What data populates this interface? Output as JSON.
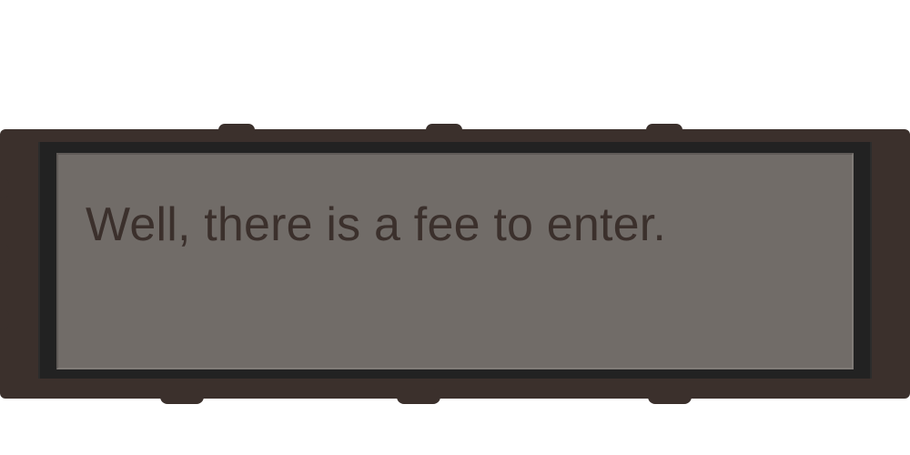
{
  "dialog": {
    "text": "Well, there is a fee to enter."
  },
  "colors": {
    "frame": "#3b302c",
    "bevel": "#222222",
    "panel": "#716c68",
    "text": "#3b302c",
    "background": "#ffffff"
  }
}
